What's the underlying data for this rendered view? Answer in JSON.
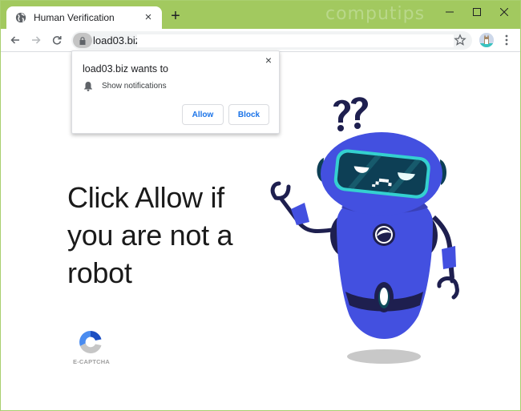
{
  "browser": {
    "tab": {
      "title": "Human Verification",
      "favicon": "globe-icon",
      "close_label": "×"
    },
    "new_tab_label": "+",
    "watermark": "computips",
    "window_controls": [
      "minimize-icon",
      "maximize-icon",
      "close-icon"
    ],
    "colors": {
      "titlebar": "#a2c95f",
      "accent_link": "#1a73e8"
    },
    "toolbar": {
      "url": "load03.biz/",
      "back_icon": "arrow-left-icon",
      "forward_icon": "arrow-right-icon",
      "reload_icon": "reload-icon",
      "lock_icon": "lock-icon",
      "bookmark_icon": "star-icon",
      "profile_icon": "avatar-icon",
      "menu_icon": "more-vert-icon"
    }
  },
  "permission_popup": {
    "title": "load03.biz wants to",
    "close_label": "×",
    "permission_icon": "bell-icon",
    "permission_text": "Show notifications",
    "allow_label": "Allow",
    "block_label": "Block"
  },
  "page": {
    "headline": "Click Allow if you are not a robot",
    "captcha_label": "E-CAPTCHA",
    "illustration": "confused-robot",
    "question_marks": "??",
    "colors": {
      "robot_body": "#4350e0",
      "robot_dark": "#1e1f4f",
      "visor": "#0d3f55",
      "visor_rim": "#34d0d0"
    }
  }
}
